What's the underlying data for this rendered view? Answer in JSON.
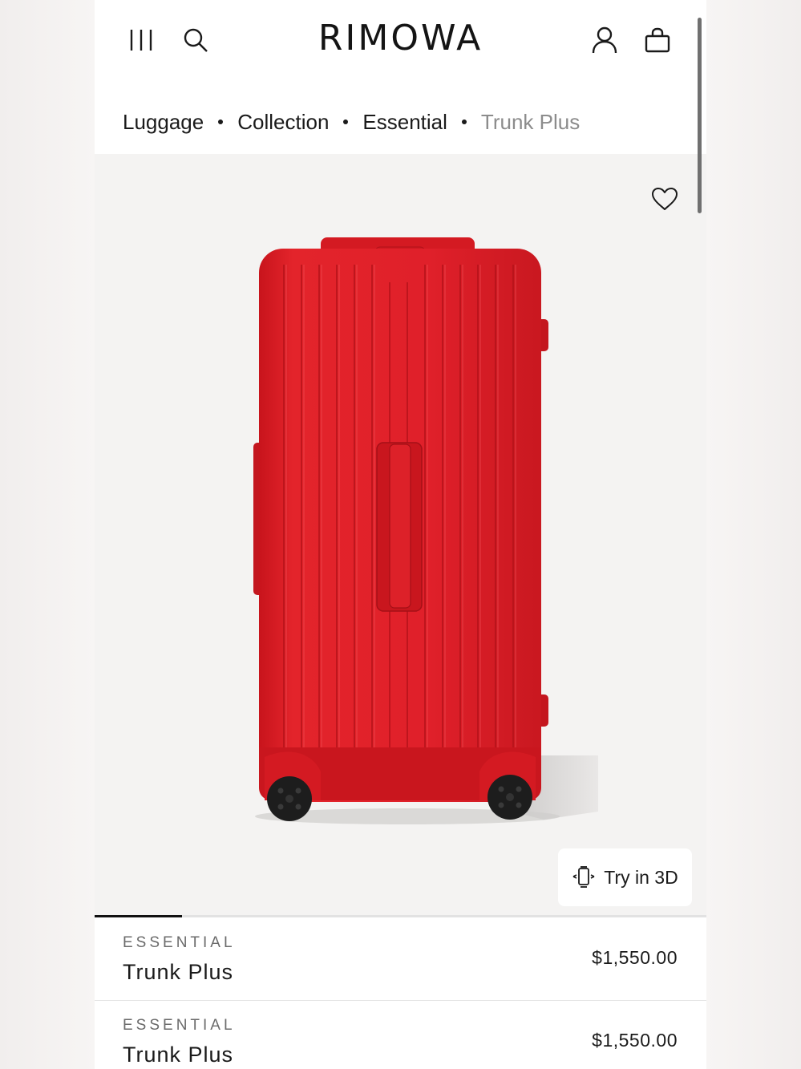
{
  "header": {
    "logo": "RIMOWA",
    "icons": {
      "menu": "menu-icon",
      "search": "search-icon",
      "account": "account-icon",
      "bag": "shopping-bag-icon"
    }
  },
  "breadcrumb": {
    "items": [
      {
        "label": "Luggage"
      },
      {
        "label": "Collection"
      },
      {
        "label": "Essential"
      },
      {
        "label": "Trunk Plus"
      }
    ]
  },
  "gallery": {
    "product_color": "#e01e26",
    "wishlist_icon": "heart-icon",
    "try3d_label": "Try in 3D",
    "try3d_icon": "ar-cube-icon",
    "slide_progress": 0.143
  },
  "products": [
    {
      "eyebrow": "ESSENTIAL",
      "name": "Trunk Plus",
      "price": "$1,550.00"
    },
    {
      "eyebrow": "ESSENTIAL",
      "name": "Trunk Plus",
      "price": "$1,550.00"
    }
  ]
}
